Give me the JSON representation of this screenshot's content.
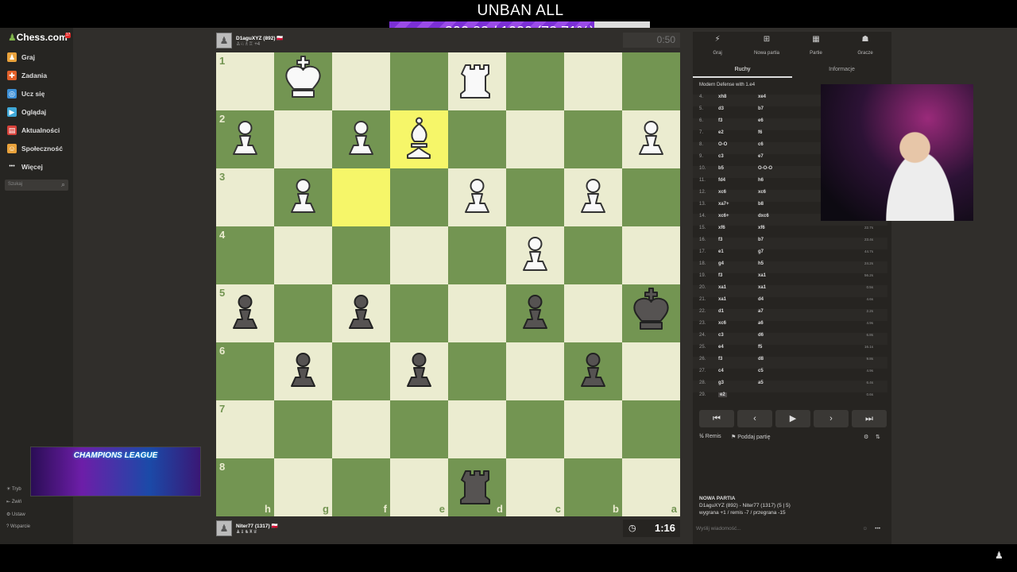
{
  "overlay": {
    "title": "UNBAN ALL",
    "progress_text": "802.83 / 1020 (78.71%)",
    "progress_fraction": 0.7871,
    "promo_text": "CHAMPIONS LEAGUE"
  },
  "sidebar": {
    "logo": "Chess.com",
    "badge": "17",
    "items": [
      {
        "label": "Graj",
        "icon": "play-pawn-icon",
        "color": "#e9a23b"
      },
      {
        "label": "Zadania",
        "icon": "puzzle-icon",
        "color": "#e2602a"
      },
      {
        "label": "Ucz się",
        "icon": "learn-icon",
        "color": "#3c8fd6"
      },
      {
        "label": "Oglądaj",
        "icon": "watch-icon",
        "color": "#3fa8d8"
      },
      {
        "label": "Aktualności",
        "icon": "news-icon",
        "color": "#d7423a"
      },
      {
        "label": "Społeczność",
        "icon": "community-icon",
        "color": "#e9a23b"
      },
      {
        "label": "Więcej",
        "icon": "more-icon",
        "color": "#bbbbbb"
      }
    ],
    "search_placeholder": "Szukaj",
    "bottom": [
      "Tryb",
      "Zwiń",
      "Ustaw",
      "Wsparcie"
    ]
  },
  "top_player": {
    "name": "D1aguXYZ (892)",
    "flag": "🇵🇱",
    "meta": "+4",
    "clock": "0:50"
  },
  "bottom_player": {
    "name": "Niter77 (1317)",
    "flag": "🇵🇱",
    "clock": "1:16"
  },
  "board": {
    "light": "#ebecd0",
    "dark": "#739552",
    "highlight": "#f6f669",
    "ranks": [
      "1",
      "2",
      "3",
      "4",
      "5",
      "6",
      "7",
      "8"
    ],
    "files": [
      "h",
      "g",
      "f",
      "e",
      "d",
      "c",
      "b",
      "a"
    ],
    "highlights": [
      [
        1,
        3
      ],
      [
        2,
        2
      ]
    ],
    "pieces": [
      {
        "row": 0,
        "col": 1,
        "type": "K",
        "color": "w"
      },
      {
        "row": 0,
        "col": 4,
        "type": "R",
        "color": "w"
      },
      {
        "row": 1,
        "col": 0,
        "type": "P",
        "color": "w"
      },
      {
        "row": 1,
        "col": 2,
        "type": "P",
        "color": "w"
      },
      {
        "row": 1,
        "col": 3,
        "type": "B",
        "color": "w"
      },
      {
        "row": 1,
        "col": 7,
        "type": "P",
        "color": "w"
      },
      {
        "row": 2,
        "col": 1,
        "type": "P",
        "color": "w"
      },
      {
        "row": 2,
        "col": 4,
        "type": "P",
        "color": "w"
      },
      {
        "row": 2,
        "col": 6,
        "type": "P",
        "color": "w"
      },
      {
        "row": 3,
        "col": 5,
        "type": "P",
        "color": "w"
      },
      {
        "row": 4,
        "col": 0,
        "type": "P",
        "color": "b"
      },
      {
        "row": 4,
        "col": 2,
        "type": "P",
        "color": "b"
      },
      {
        "row": 4,
        "col": 5,
        "type": "P",
        "color": "b"
      },
      {
        "row": 4,
        "col": 7,
        "type": "K",
        "color": "b"
      },
      {
        "row": 5,
        "col": 1,
        "type": "P",
        "color": "b"
      },
      {
        "row": 5,
        "col": 3,
        "type": "P",
        "color": "b"
      },
      {
        "row": 5,
        "col": 6,
        "type": "P",
        "color": "b"
      },
      {
        "row": 7,
        "col": 4,
        "type": "R",
        "color": "b"
      }
    ]
  },
  "panel": {
    "tabs": [
      {
        "label": "Graj",
        "icon": "lightning-icon"
      },
      {
        "label": "Nowa partia",
        "icon": "plus-icon"
      },
      {
        "label": "Partie",
        "icon": "board-icon"
      },
      {
        "label": "Gracze",
        "icon": "players-icon"
      }
    ],
    "subtabs": [
      "Ruchy",
      "Informacje"
    ],
    "opening": "Modern Defense with 1.e4",
    "moves": [
      {
        "n": "4.",
        "w": "xh8",
        "b": "xe4",
        "t": ""
      },
      {
        "n": "5.",
        "w": "d3",
        "b": "b7",
        "t": ""
      },
      {
        "n": "6.",
        "w": "f3",
        "b": "e6",
        "t": ""
      },
      {
        "n": "7.",
        "w": "e2",
        "b": "f6",
        "t": ""
      },
      {
        "n": "8.",
        "w": "O-O",
        "b": "c6",
        "t": ""
      },
      {
        "n": "9.",
        "w": "c3",
        "b": "e7",
        "t": ""
      },
      {
        "n": "10.",
        "w": "b5",
        "b": "O-O-O",
        "t": ""
      },
      {
        "n": "11.",
        "w": "fd4",
        "b": "h6",
        "t": ""
      },
      {
        "n": "12.",
        "w": "xc6",
        "b": "xc6",
        "t": ""
      },
      {
        "n": "13.",
        "w": "xa7+",
        "b": "b8",
        "t": ""
      },
      {
        "n": "14.",
        "w": "xc6+",
        "b": "dxc6",
        "t": ""
      },
      {
        "n": "15.",
        "w": "xf6",
        "b": "xf6",
        "t": "22.7s"
      },
      {
        "n": "16.",
        "w": "f3",
        "b": "b7",
        "t": "23.4s"
      },
      {
        "n": "17.",
        "w": "e1",
        "b": "g7",
        "t": "44.7s"
      },
      {
        "n": "18.",
        "w": "g4",
        "b": "h5",
        "t": "24.2s"
      },
      {
        "n": "19.",
        "w": "f3",
        "b": "xa1",
        "t": "56.2s"
      },
      {
        "n": "20.",
        "w": "xa1",
        "b": "xa1",
        "t": "0.5s"
      },
      {
        "n": "21.",
        "w": "xa1",
        "b": "d4",
        "t": "4.6s"
      },
      {
        "n": "22.",
        "w": "d1",
        "b": "a7",
        "t": "2.2s"
      },
      {
        "n": "23.",
        "w": "xc6",
        "b": "a6",
        "t": "4.9s"
      },
      {
        "n": "24.",
        "w": "c3",
        "b": "d6",
        "t": "6.8s"
      },
      {
        "n": "25.",
        "w": "e4",
        "b": "f5",
        "t": "16.1s"
      },
      {
        "n": "26.",
        "w": "f3",
        "b": "d8",
        "t": "9.8s"
      },
      {
        "n": "27.",
        "w": "c4",
        "b": "c5",
        "t": "4.9s"
      },
      {
        "n": "28.",
        "w": "g3",
        "b": "a5",
        "t": "6.4s"
      },
      {
        "n": "29.",
        "w": "e2",
        "b": "",
        "t": "0.6s"
      }
    ],
    "nav": [
      "⏮",
      "‹",
      "▶",
      "›",
      "⏭"
    ],
    "actions": {
      "draw": "Remis",
      "resign": "Poddaj partię",
      "draw_icon": "½"
    },
    "game_info": {
      "title": "NOWA PARTIA",
      "players": "D1aguXYZ (892) - Niter77 (1317) (5 | 5)",
      "stakes": "wygrana +1 / remis -7 / przegrana -15"
    },
    "message_placeholder": "Wyślij wiadomość..."
  }
}
